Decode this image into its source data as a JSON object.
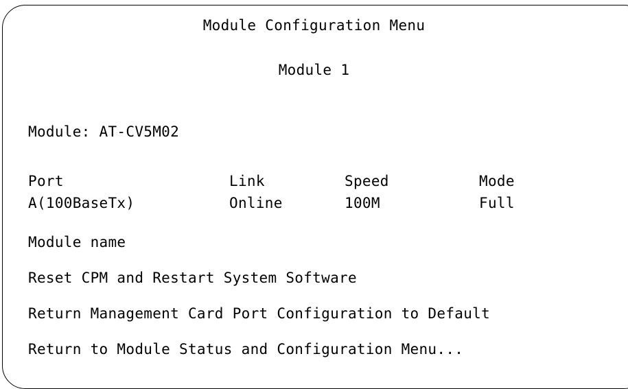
{
  "screen": {
    "title": "Module Configuration Menu",
    "subtitle": "Module 1",
    "module_label": "Module: AT-CV5M02"
  },
  "port_table": {
    "headers": [
      "Port",
      "Link",
      "Speed",
      "Mode"
    ],
    "rows": [
      [
        "A(100BaseTx)",
        "Online",
        "100M",
        "Full"
      ]
    ]
  },
  "menu": {
    "items": [
      "Module name",
      "Reset CPM and Restart System Software",
      "Return Management Card Port Configuration to Default",
      "Return to Module Status and Configuration Menu..."
    ]
  }
}
